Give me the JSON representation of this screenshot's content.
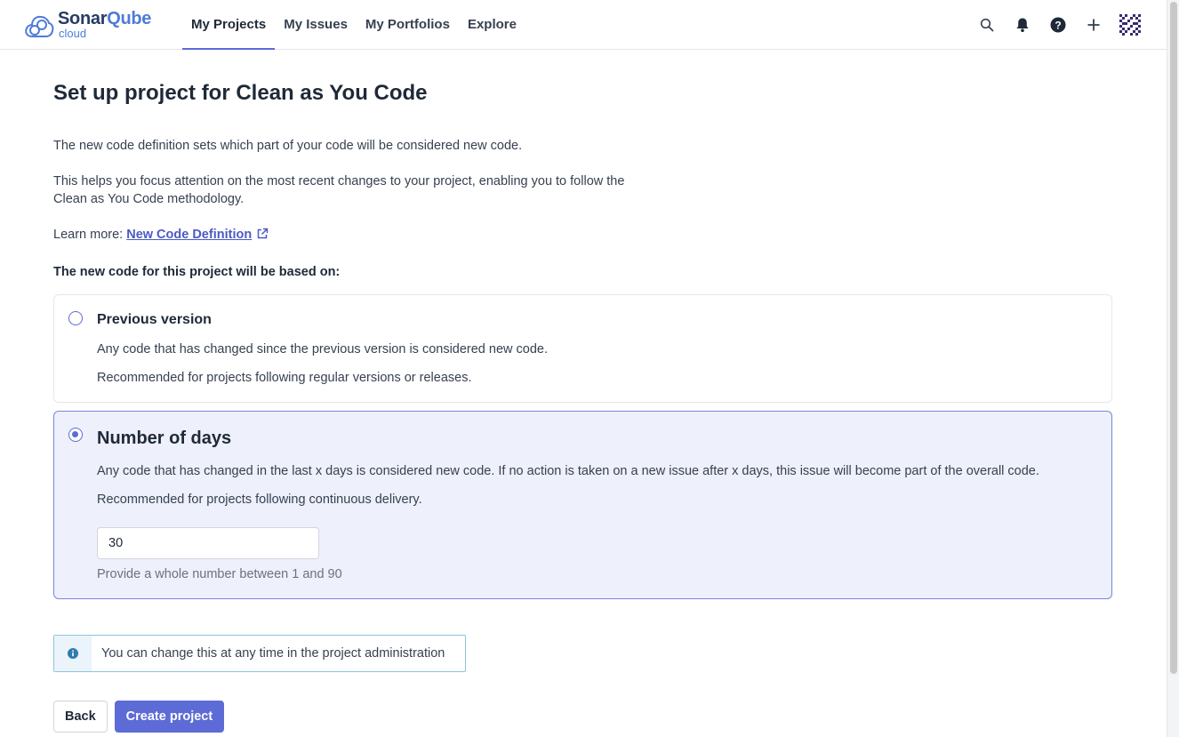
{
  "header": {
    "logo_brand": "Sonar",
    "logo_brand_accent": "Qube",
    "logo_sub": "cloud",
    "nav": [
      {
        "label": "My Projects",
        "active": true
      },
      {
        "label": "My Issues",
        "active": false
      },
      {
        "label": "My Portfolios",
        "active": false
      },
      {
        "label": "Explore",
        "active": false
      }
    ],
    "icons": [
      "search-icon",
      "bell-icon",
      "help-icon",
      "plus-icon",
      "avatar"
    ]
  },
  "page": {
    "title": "Set up project for Clean as You Code",
    "intro1": "The new code definition sets which part of your code will be considered new code.",
    "intro2": "This helps you focus attention on the most recent changes to your project, enabling you to follow the Clean as You Code methodology.",
    "learn_more_label": "Learn more:",
    "learn_more_link": "New Code Definition",
    "based_on": "The new code for this project will be based on:"
  },
  "options": {
    "previous_version": {
      "title": "Previous version",
      "desc1": "Any code that has changed since the previous version is considered new code.",
      "desc2": "Recommended for projects following regular versions or releases.",
      "selected": false
    },
    "number_of_days": {
      "title": "Number of days",
      "desc1": "Any code that has changed in the last x days is considered new code. If no action is taken on a new issue after x days, this issue will become part of the overall code.",
      "desc2": "Recommended for projects following continuous delivery.",
      "value": "30",
      "hint": "Provide a whole number between 1 and 90",
      "selected": true
    }
  },
  "info": {
    "text": "You can change this at any time in the project administration"
  },
  "buttons": {
    "back": "Back",
    "create": "Create project"
  },
  "colors": {
    "accent": "#5d6bd6",
    "link": "#4c5ac5",
    "selected_bg": "#eef0fb",
    "info_border": "#8fc3dc"
  }
}
